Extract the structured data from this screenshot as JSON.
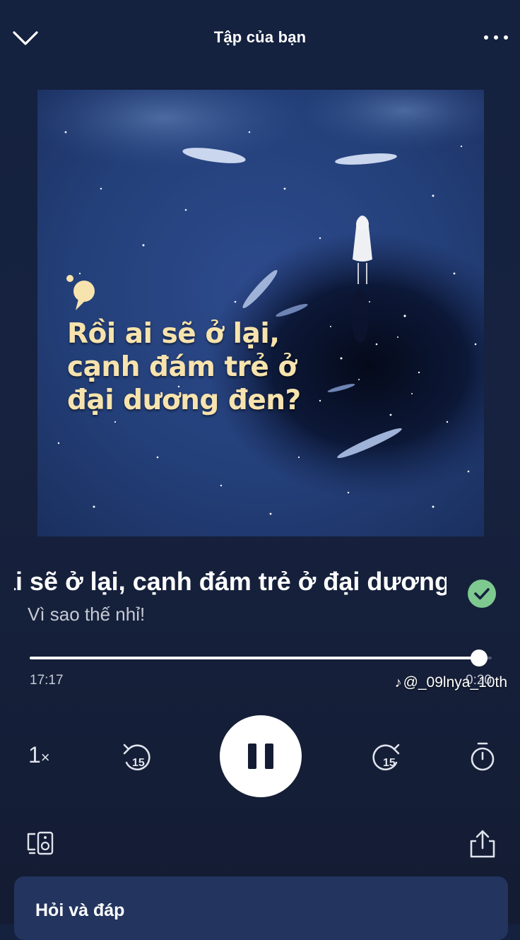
{
  "header": {
    "title": "Tập của bạn",
    "collapse_icon": "chevron-down-icon",
    "more_icon": "more-horizontal-icon"
  },
  "artwork": {
    "quote_lines": [
      "Rồi ai sẽ ở lại,",
      "cạnh đám trẻ ở",
      "đại dương đen?"
    ],
    "quote_color": "#f7e3ad"
  },
  "episode": {
    "title": "Rồi ai sẽ ở lại, cạnh đám trẻ ở đại dương đen?",
    "show": "Vì sao thế nhỉ!",
    "saved": true,
    "saved_color": "#7ec98f"
  },
  "playback": {
    "elapsed": "17:17",
    "remaining": "0:20",
    "progress": 0.972,
    "speed": "1",
    "speed_suffix": "×",
    "skip_back_seconds": "15",
    "skip_forward_seconds": "15",
    "state": "playing"
  },
  "watermark": {
    "text": "@_09lnya_10th",
    "logo": "♪"
  },
  "footer": {
    "device_icon": "connect-device-icon",
    "share_icon": "share-icon"
  },
  "qa_section": {
    "title": "Hỏi và đáp"
  }
}
